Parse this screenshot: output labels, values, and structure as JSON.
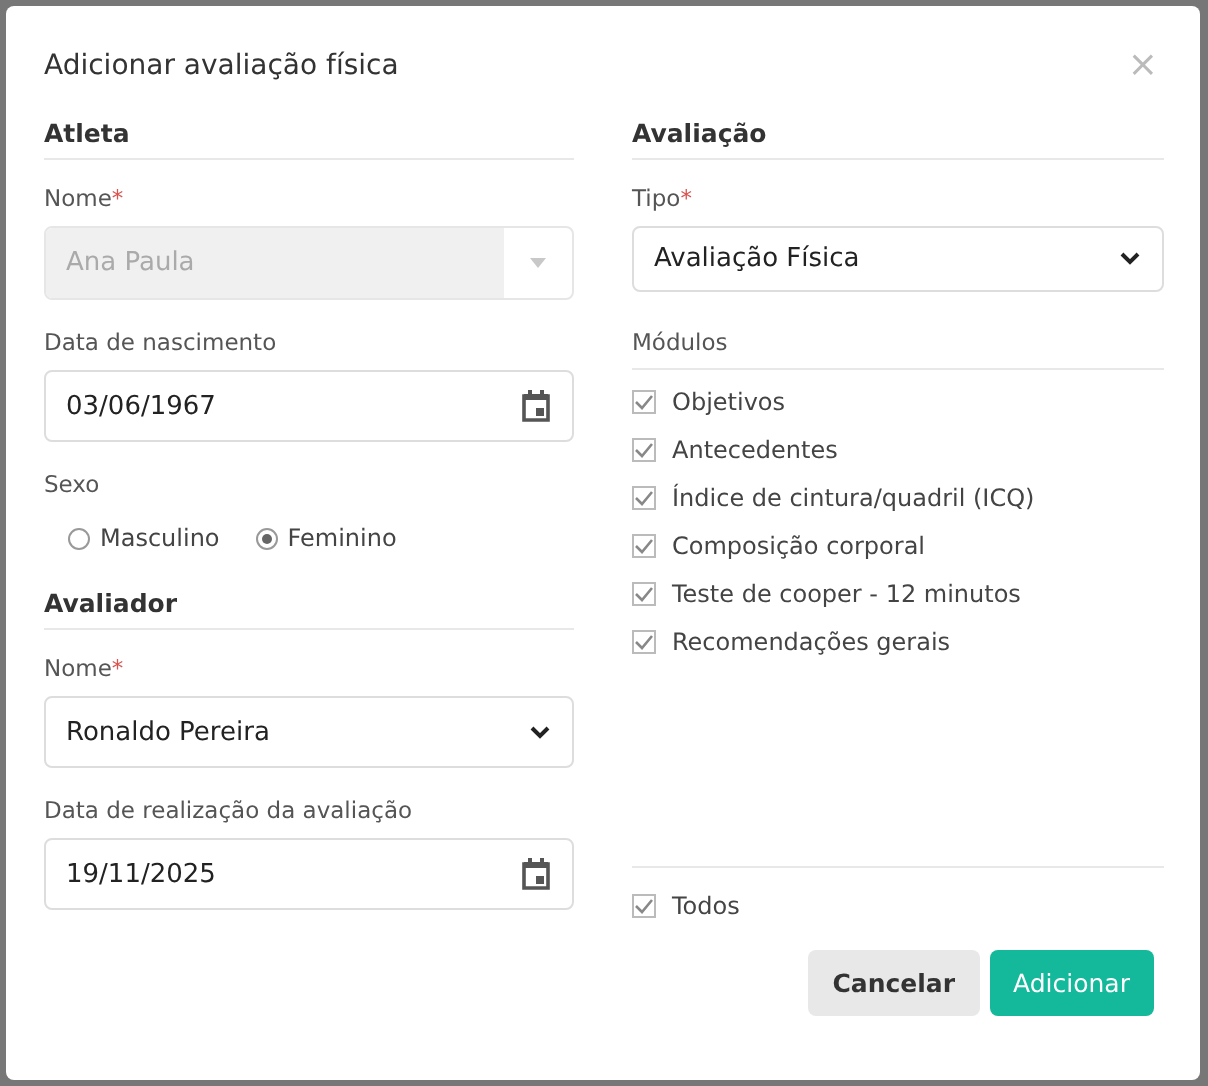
{
  "dialog": {
    "title": "Adicionar avaliação física",
    "close": "×"
  },
  "atleta": {
    "heading": "Atleta",
    "nome": {
      "label": "Nome",
      "required_mark": "*",
      "value": "Ana Paula",
      "disabled": true
    },
    "nascimento": {
      "label": "Data de nascimento",
      "value": "03/06/1967"
    },
    "sexo": {
      "label": "Sexo",
      "options": [
        {
          "label": "Masculino",
          "selected": false
        },
        {
          "label": "Feminino",
          "selected": true
        }
      ]
    }
  },
  "avaliador": {
    "heading": "Avaliador",
    "nome": {
      "label": "Nome",
      "required_mark": "*",
      "value": "Ronaldo Pereira"
    },
    "data": {
      "label": "Data de realização da avaliação",
      "value": "19/11/2025"
    }
  },
  "avaliacao": {
    "heading": "Avaliação",
    "tipo": {
      "label": "Tipo",
      "required_mark": "*",
      "value": "Avaliação Física"
    },
    "modulos": {
      "label": "Módulos",
      "items": [
        {
          "label": "Objetivos",
          "checked": true
        },
        {
          "label": "Antecedentes",
          "checked": true
        },
        {
          "label": "Índice de cintura/quadril (ICQ)",
          "checked": true
        },
        {
          "label": "Composição corporal",
          "checked": true
        },
        {
          "label": "Teste de cooper - 12 minutos",
          "checked": true
        },
        {
          "label": "Recomendações gerais",
          "checked": true
        }
      ],
      "todos": {
        "label": "Todos",
        "checked": true
      }
    }
  },
  "buttons": [
    {
      "label": "Cancelar",
      "kind": "secondary"
    },
    {
      "label": "Adicionar",
      "kind": "primary"
    }
  ]
}
